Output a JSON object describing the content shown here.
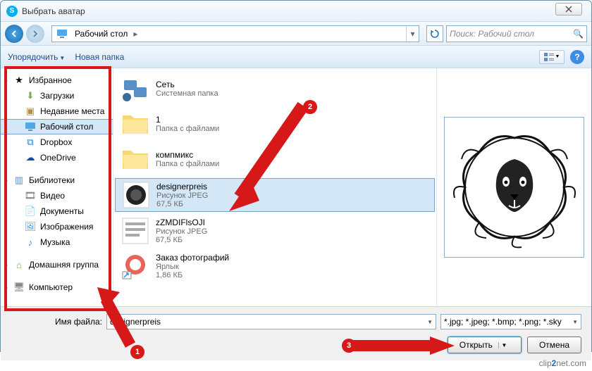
{
  "title": "Выбрать аватар",
  "breadcrumb": {
    "location": "Рабочий стол"
  },
  "search": {
    "placeholder": "Поиск: Рабочий стол"
  },
  "toolbar": {
    "organize": "Упорядочить",
    "newfolder": "Новая папка"
  },
  "sidebar": {
    "fav": "Избранное",
    "downloads": "Загрузки",
    "recent": "Недавние места",
    "desktop": "Рабочий стол",
    "dropbox": "Dropbox",
    "onedrive": "OneDrive",
    "libs": "Библиотеки",
    "video": "Видео",
    "docs": "Документы",
    "images": "Изображения",
    "music": "Музыка",
    "homegroup": "Домашняя группа",
    "computer": "Компьютер"
  },
  "files": [
    {
      "name": "Сеть",
      "meta1": "Системная папка",
      "meta2": ""
    },
    {
      "name": "1",
      "meta1": "Папка с файлами",
      "meta2": ""
    },
    {
      "name": "компмикс",
      "meta1": "Папка с файлами",
      "meta2": ""
    },
    {
      "name": "designerpreis",
      "meta1": "Рисунок JPEG",
      "meta2": "67,5 КБ"
    },
    {
      "name": "zZMDIFlsOJI",
      "meta1": "Рисунок JPEG",
      "meta2": "67,5 КБ"
    },
    {
      "name": "Заказ фотографий",
      "meta1": "Ярлык",
      "meta2": "1,86 КБ"
    }
  ],
  "filename": {
    "label": "Имя файла:",
    "value": "designerpreis"
  },
  "filter": "*.jpg; *.jpeg; *.bmp; *.png; *.sky",
  "buttons": {
    "open": "Открыть",
    "cancel": "Отмена"
  },
  "annot": {
    "n1": "1",
    "n2": "2",
    "n3": "3"
  },
  "watermark": {
    "a": "clip",
    "b": "2",
    "c": "net.com"
  }
}
